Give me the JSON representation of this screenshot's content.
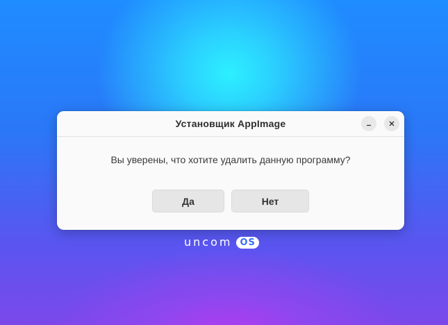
{
  "dialog": {
    "title": "Установщик AppImage",
    "message": "Вы уверены, что хотите удалить данную программу?",
    "yes_label": "Да",
    "no_label": "Нет",
    "minimize_icon": "minimize-icon",
    "close_icon": "close-icon"
  },
  "desktop": {
    "logo_text": "uncom",
    "logo_badge": "OS"
  },
  "colors": {
    "dialog_bg": "#fafafa",
    "button_bg": "#e6e6e6",
    "wallpaper_center": "#2cf0ff",
    "wallpaper_bottom": "#b03cf0"
  }
}
